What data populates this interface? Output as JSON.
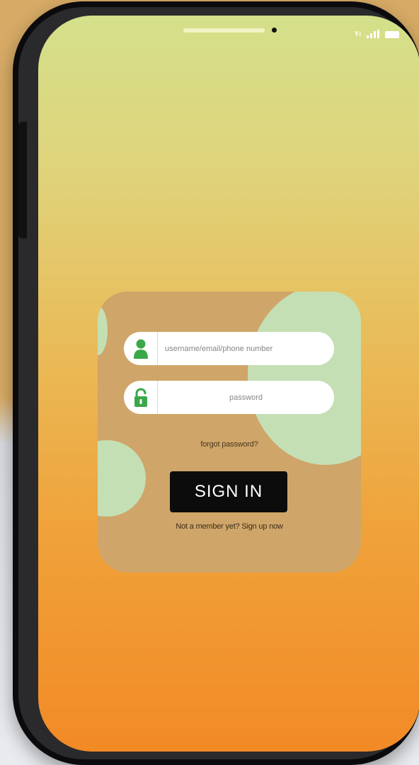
{
  "status_bar": {
    "network_label": "Yı",
    "signal_icon": "signal-bars-icon",
    "battery_icon": "battery-icon"
  },
  "login": {
    "username": {
      "icon": "user-icon",
      "placeholder": "username/email/phone number",
      "value": ""
    },
    "password": {
      "icon": "lock-icon",
      "placeholder": "password",
      "value": ""
    },
    "forgot_label": "forgot password?",
    "signin_label": "SIGN IN",
    "signup_prompt": "Not a member yet?",
    "signup_link_label": "Sign up now"
  },
  "colors": {
    "screen_top": "#d4e08a",
    "screen_bottom": "#f28a26",
    "card": "#cfa569",
    "blob": "#c5dfb5",
    "icon_green": "#3aa848",
    "button": "#0c0c0c"
  }
}
